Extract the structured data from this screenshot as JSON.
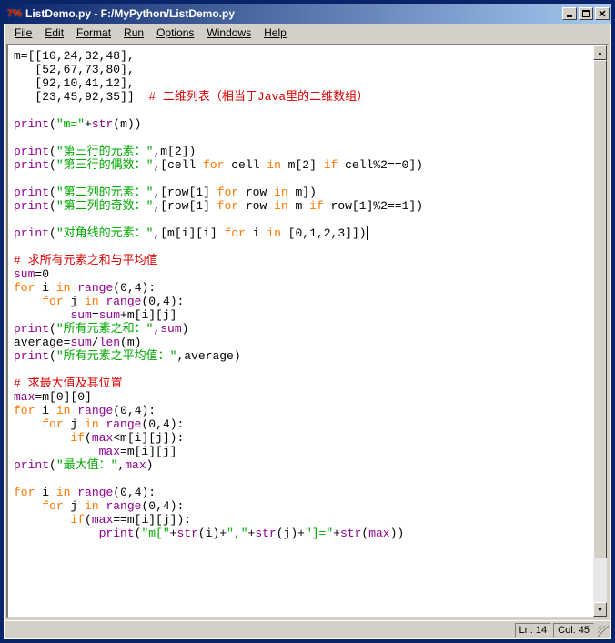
{
  "title": "ListDemo.py - F:/MyPython/ListDemo.py",
  "menu": [
    "File",
    "Edit",
    "Format",
    "Run",
    "Options",
    "Windows",
    "Help"
  ],
  "status": {
    "ln": "Ln: 14",
    "col": "Col: 45"
  },
  "code": {
    "l1a": "m=[[",
    "l1b": "10",
    "l1c": ",",
    "l1d": "24",
    "l1e": ",",
    "l1f": "32",
    "l1g": ",",
    "l1h": "48",
    "l1i": "],",
    "l2a": "   [",
    "l2b": "52",
    "l2c": ",",
    "l2d": "67",
    "l2e": ",",
    "l2f": "73",
    "l2g": ",",
    "l2h": "80",
    "l2i": "],",
    "l3a": "   [",
    "l3b": "92",
    "l3c": ",",
    "l3d": "10",
    "l3e": ",",
    "l3f": "41",
    "l3g": ",",
    "l3h": "12",
    "l3i": "],",
    "l4a": "   [",
    "l4b": "23",
    "l4c": ",",
    "l4d": "45",
    "l4e": ",",
    "l4f": "92",
    "l4g": ",",
    "l4h": "35",
    "l4i": "]]  ",
    "l4cm": "# 二维列表（相当于Java里的二维数组）",
    "pm1": "print",
    "pm2": "(",
    "pm3": "\"m=\"",
    "pm4": "+",
    "pm5": "str",
    "pm6": "(m))",
    "pa1": "print",
    "pa2": "(",
    "pa3": "\"第三行的元素：\"",
    "pa4": ",m[",
    "pa5": "2",
    "pa6": "])",
    "pb1": "print",
    "pb2": "(",
    "pb3": "\"第三行的偶数：\"",
    "pb4": ",[cell ",
    "pb5": "for",
    "pb6": " cell ",
    "pb7": "in",
    "pb8": " m[",
    "pb9": "2",
    "pb10": "] ",
    "pb11": "if",
    "pb12": " cell%",
    "pb13": "2",
    "pb14": "==",
    "pb15": "0",
    "pb16": "])",
    "pc1": "print",
    "pc2": "(",
    "pc3": "\"第二列的元素：\"",
    "pc4": ",[row[",
    "pc5": "1",
    "pc6": "] ",
    "pc7": "for",
    "pc8": " row ",
    "pc9": "in",
    "pc10": " m])",
    "pd1": "print",
    "pd2": "(",
    "pd3": "\"第二列的奇数：\"",
    "pd4": ",[row[",
    "pd5": "1",
    "pd6": "] ",
    "pd7": "for",
    "pd8": " row ",
    "pd9": "in",
    "pd10": " m ",
    "pd11": "if",
    "pd12": " row[",
    "pd13": "1",
    "pd14": "]%",
    "pd15": "2",
    "pd16": "==",
    "pd17": "1",
    "pd18": "])",
    "pe1": "print",
    "pe2": "(",
    "pe3": "\"对角线的元素：\"",
    "pe4": ",[m[i][i] ",
    "pe5": "for",
    "pe6": " i ",
    "pe7": "in",
    "pe8": " [",
    "pe9": "0",
    "pe10": ",",
    "pe11": "1",
    "pe12": ",",
    "pe13": "2",
    "pe14": ",",
    "pe15": "3",
    "pe16": "]])",
    "cm2": "# 求所有元素之和与平均值",
    "s1": "sum",
    "s2": "=",
    "s3": "0",
    "f1a": "for",
    "f1b": " i ",
    "f1c": "in",
    "f1d": " ",
    "f1e": "range",
    "f1f": "(",
    "f1g": "0",
    "f1h": ",",
    "f1i": "4",
    "f1j": "):",
    "f2a": "    ",
    "f2b": "for",
    "f2c": " j ",
    "f2d": "in",
    "f2e": " ",
    "f2f": "range",
    "f2g": "(",
    "f2h": "0",
    "f2i": ",",
    "f2j": "4",
    "f2k": "):",
    "f3a": "        ",
    "f3b": "sum",
    "f3c": "=",
    "f3d": "sum",
    "f3e": "+m[i][j]",
    "ps1": "print",
    "ps2": "(",
    "ps3": "\"所有元素之和：\"",
    "ps4": ",",
    "ps5": "sum",
    "ps6": ")",
    "av1": "average=",
    "av2": "sum",
    "av3": "/",
    "av4": "len",
    "av5": "(m)",
    "pa21": "print",
    "pa22": "(",
    "pa23": "\"所有元素之平均值：\"",
    "pa24": ",average)",
    "cm3": "# 求最大值及其位置",
    "mx1": "max",
    "mx2": "=m[",
    "mx3": "0",
    "mx4": "][",
    "mx5": "0",
    "mx6": "]",
    "g1a": "for",
    "g1b": " i ",
    "g1c": "in",
    "g1d": " ",
    "g1e": "range",
    "g1f": "(",
    "g1g": "0",
    "g1h": ",",
    "g1i": "4",
    "g1j": "):",
    "g2a": "    ",
    "g2b": "for",
    "g2c": " j ",
    "g2d": "in",
    "g2e": " ",
    "g2f": "range",
    "g2g": "(",
    "g2h": "0",
    "g2i": ",",
    "g2j": "4",
    "g2k": "):",
    "g3a": "        ",
    "g3b": "if",
    "g3c": "(",
    "g3d": "max",
    "g3e": "<m[i][j]):",
    "g4a": "            ",
    "g4b": "max",
    "g4c": "=m[i][j]",
    "pm21": "print",
    "pm22": "(",
    "pm23": "\"最大值：\"",
    "pm24": ",",
    "pm25": "max",
    "pm26": ")",
    "h1a": "for",
    "h1b": " i ",
    "h1c": "in",
    "h1d": " ",
    "h1e": "range",
    "h1f": "(",
    "h1g": "0",
    "h1h": ",",
    "h1i": "4",
    "h1j": "):",
    "h2a": "    ",
    "h2b": "for",
    "h2c": " j ",
    "h2d": "in",
    "h2e": " ",
    "h2f": "range",
    "h2g": "(",
    "h2h": "0",
    "h2i": ",",
    "h2j": "4",
    "h2k": "):",
    "h3a": "        ",
    "h3b": "if",
    "h3c": "(",
    "h3d": "max",
    "h3e": "==m[i][j]):",
    "h4a": "            ",
    "h4b": "print",
    "h4c": "(",
    "h4d": "\"m[\"",
    "h4e": "+",
    "h4f": "str",
    "h4g": "(i)+",
    "h4h": "\",\"",
    "h4i": "+",
    "h4j": "str",
    "h4k": "(j)+",
    "h4l": "\"]=\"",
    "h4m": "+",
    "h4n": "str",
    "h4o": "(",
    "h4p": "max",
    "h4q": "))"
  }
}
